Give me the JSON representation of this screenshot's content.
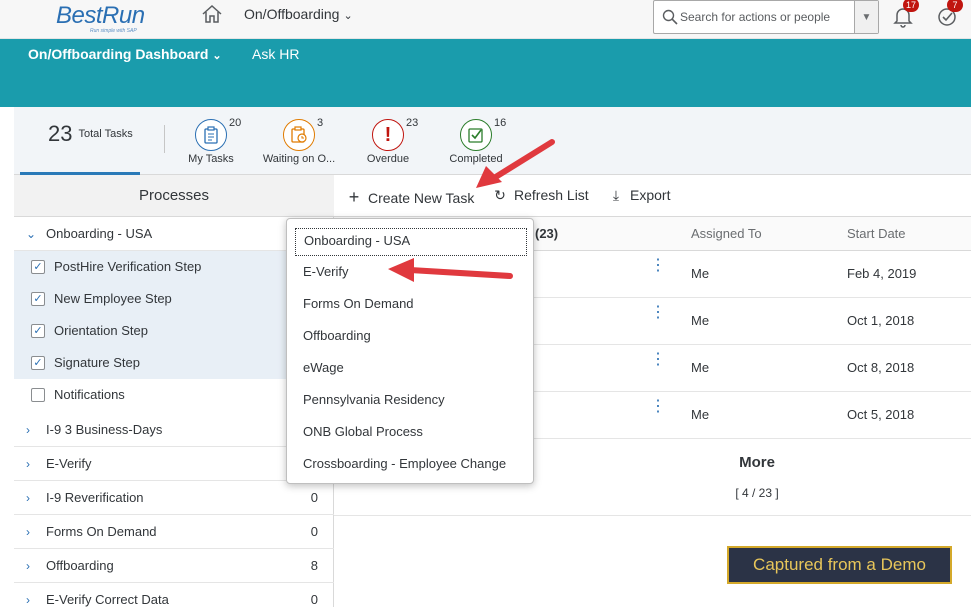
{
  "shell": {
    "logo_text": "BestRun",
    "logo_subtext": "Run simple with SAP",
    "app_title": "On/Offboarding",
    "search_placeholder": "Search for actions or people",
    "notifications_count": "17",
    "tasks_count": "7"
  },
  "nav": {
    "dashboard_label": "On/Offboarding Dashboard",
    "ask_hr_label": "Ask HR"
  },
  "summary": {
    "total_count": "23",
    "total_label": "Total Tasks",
    "tiles": [
      {
        "label": "My Tasks",
        "count": "20",
        "icon": "clipboard-icon",
        "color": "#2a6fb3"
      },
      {
        "label": "Waiting on O...",
        "count": "3",
        "icon": "waiting-icon",
        "color": "#e07b00"
      },
      {
        "label": "Overdue",
        "count": "23",
        "icon": "alert-icon",
        "color": "#c0150f"
      },
      {
        "label": "Completed",
        "count": "16",
        "icon": "check-icon",
        "color": "#2b7d2b"
      }
    ]
  },
  "processes": {
    "title": "Processes",
    "groups": [
      {
        "label": "Onboarding - USA",
        "expanded": true
      },
      {
        "label": "I-9 3 Business-Days",
        "count": ""
      },
      {
        "label": "E-Verify",
        "count": ""
      },
      {
        "label": "I-9 Reverification",
        "count": "0"
      },
      {
        "label": "Forms On Demand",
        "count": "0"
      },
      {
        "label": "Offboarding",
        "count": "8"
      },
      {
        "label": "E-Verify Correct Data",
        "count": "0"
      }
    ],
    "steps": [
      {
        "label": "PostHire Verification Step",
        "checked": true
      },
      {
        "label": "New Employee Step",
        "checked": true
      },
      {
        "label": "Orientation Step",
        "checked": true
      },
      {
        "label": "Signature Step",
        "checked": true
      },
      {
        "label": "Notifications",
        "checked": false
      }
    ]
  },
  "toolbar": {
    "create_label": "Create New Task",
    "refresh_label": "Refresh List",
    "export_label": "Export"
  },
  "table": {
    "count_header": "(23)",
    "assigned_header": "Assigned To",
    "start_header": "Start Date",
    "rows": [
      {
        "assigned": "Me",
        "start": "Feb 4, 2019"
      },
      {
        "assigned": "Me",
        "start": "Oct 1, 2018"
      },
      {
        "assigned": "Me",
        "start": "Oct 8, 2018"
      },
      {
        "assigned": "Me",
        "start": "Oct 5, 2018"
      }
    ],
    "more_label": "More",
    "more_count": "[ 4 / 23 ]"
  },
  "dropdown": {
    "items": [
      "Onboarding - USA",
      "E-Verify",
      "Forms On Demand",
      "Offboarding",
      "eWage",
      "Pennsylvania Residency",
      "ONB Global Process",
      "Crossboarding - Employee Change"
    ]
  },
  "demo_tag": "Captured from a Demo",
  "colors": {
    "teal": "#1a9cac",
    "accent_blue": "#2a6fb3",
    "arrow_red": "#e0393e",
    "demo_bg": "#2b3346",
    "demo_border": "#d4a92a"
  }
}
